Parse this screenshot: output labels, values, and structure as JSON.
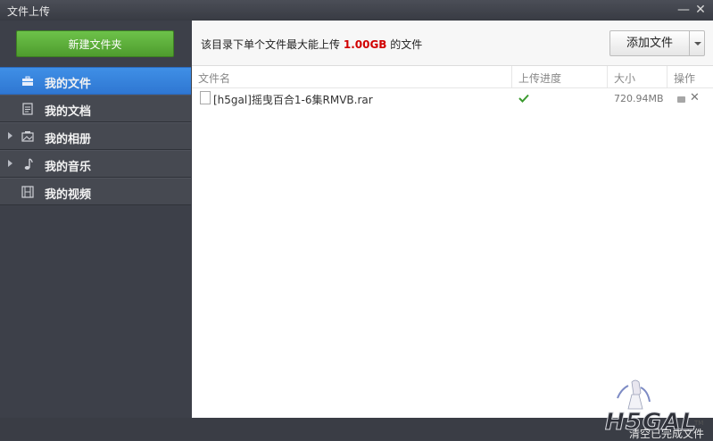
{
  "window": {
    "title": "文件上传",
    "minimize_label": "—",
    "close_label": "✕"
  },
  "sidebar": {
    "new_folder_label": "新建文件夹",
    "items": [
      {
        "label": "我的文件",
        "icon": "briefcase-icon",
        "active": true,
        "expandable": false
      },
      {
        "label": "我的文档",
        "icon": "document-icon",
        "active": false,
        "expandable": false
      },
      {
        "label": "我的相册",
        "icon": "photo-album-icon",
        "active": false,
        "expandable": true
      },
      {
        "label": "我的音乐",
        "icon": "music-note-icon",
        "active": false,
        "expandable": true
      },
      {
        "label": "我的视频",
        "icon": "film-icon",
        "active": false,
        "expandable": false
      }
    ]
  },
  "toolbar": {
    "notice_prefix": "该目录下单个文件最大能上传",
    "notice_limit": "1.00GB",
    "notice_suffix": "的文件",
    "add_file_label": "添加文件"
  },
  "table": {
    "columns": [
      "文件名",
      "上传进度",
      "大小",
      "操作"
    ],
    "rows": [
      {
        "name": "[h5gal]摇曳百合1-6集RMVB.rar",
        "status": "complete",
        "size": "720.94MB"
      }
    ]
  },
  "footer": {
    "clear_label": "清空已完成文件"
  },
  "watermark": {
    "text": "H5GAL",
    "tm": "TM"
  },
  "colors": {
    "accent": "#2f77d2",
    "green_button": "#5aad3a",
    "limit_red": "#d10000",
    "check_green": "#3a9a2e"
  }
}
